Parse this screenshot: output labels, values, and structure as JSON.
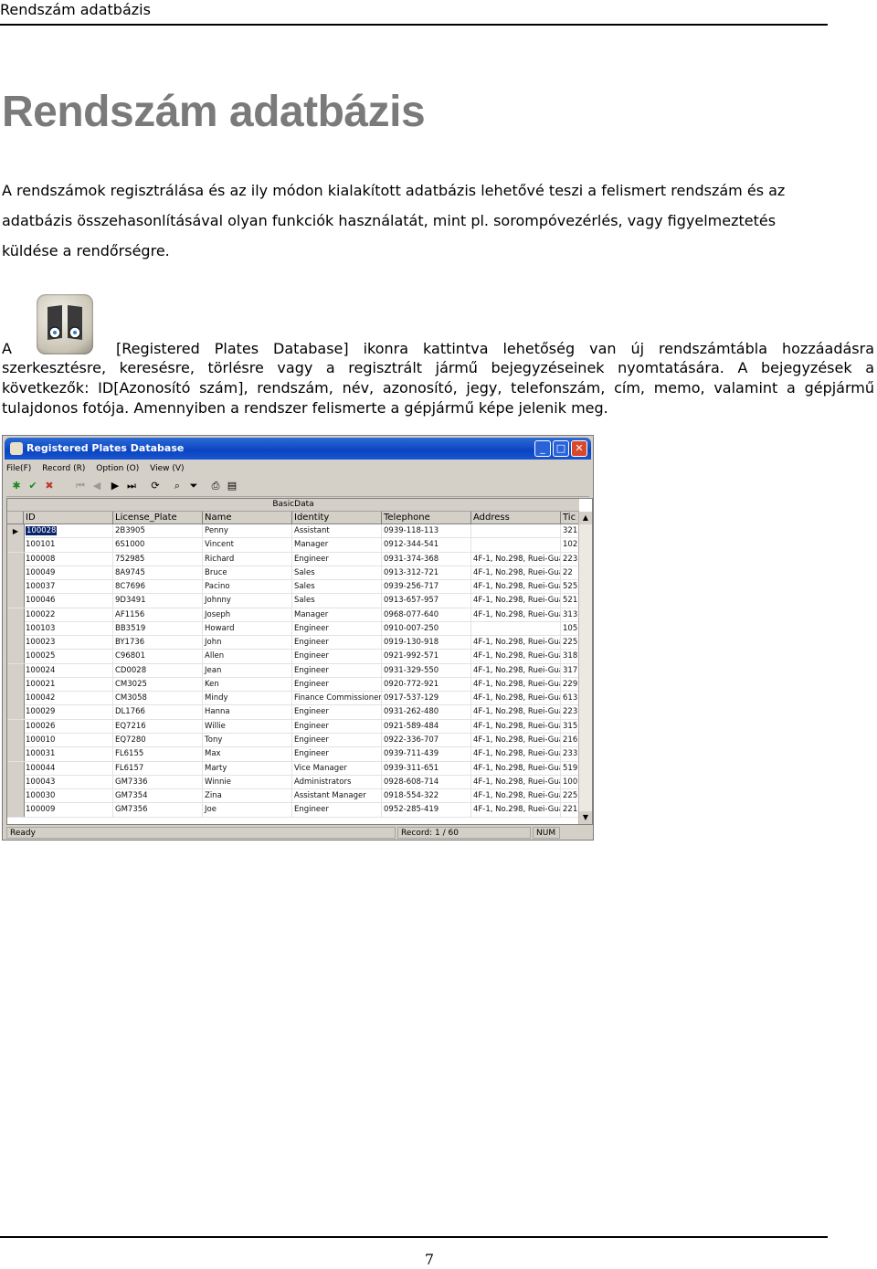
{
  "header": {
    "running_title": "Rendszám adatbázis"
  },
  "title": "Rendszám adatbázis",
  "intro_lines": [
    "A rendszámok regisztrálása és az ily módon kialakított adatbázis lehetővé teszi a felismert rendszám és az",
    "adatbázis összehasonlításával olyan funkciók használatát, mint pl. sorompóvezérlés, vagy figyelmeztetés",
    "küldése a rendőrségre."
  ],
  "para2": {
    "first_word": "A",
    "first_line_rest": "[Registered Plates Database] ikonra kattintva lehetőség van új rendszámtábla hozzáadásra",
    "lines": [
      "szerkesztésre, keresésre, törlésre vagy a regisztrált jármű bejegyzéseinek nyomtatására. A bejegyzések a",
      "következők: ID[Azonosító szám], rendszám, név, azonosító, jegy, telefonszám, cím, memo, valamint a gépjármű",
      "tulajdonos fotója. Amennyiben a rendszer felismerte a gépjármű képe jelenik meg."
    ]
  },
  "window": {
    "title": "Registered Plates Database",
    "menu": [
      "File(F)",
      "Record (R)",
      "Option (O)",
      "View (V)"
    ],
    "band": "BasicData",
    "columns": [
      "ID",
      "License_Plate",
      "Name",
      "Identity",
      "Telephone",
      "Address",
      "Tic"
    ],
    "rows": [
      [
        "100028",
        "2B3905",
        "Penny",
        "Assistant",
        "0939-118-113",
        "",
        "321"
      ],
      [
        "100101",
        "6S1000",
        "Vincent",
        "Manager",
        "0912-344-541",
        "",
        "102"
      ],
      [
        "100008",
        "752985",
        "Richard",
        "Engineer",
        "0931-374-368",
        "4F-1, No.298, Ruei-Gua",
        "223"
      ],
      [
        "100049",
        "8A9745",
        "Bruce",
        "Sales",
        "0913-312-721",
        "4F-1, No.298, Ruei-Gua",
        "22"
      ],
      [
        "100037",
        "8C7696",
        "Pacino",
        "Sales",
        "0939-256-717",
        "4F-1, No.298, Ruei-Gua",
        "525"
      ],
      [
        "100046",
        "9D3491",
        "Johnny",
        "Sales",
        "0913-657-957",
        "4F-1, No.298, Ruei-Gua",
        "521"
      ],
      [
        "100022",
        "AF1156",
        "Joseph",
        "Manager",
        "0968-077-640",
        "4F-1, No.298, Ruei-Gua",
        "313"
      ],
      [
        "100103",
        "BB3519",
        "Howard",
        "Engineer",
        "0910-007-250",
        "",
        "105"
      ],
      [
        "100023",
        "BY1736",
        "John",
        "Engineer",
        "0919-130-918",
        "4F-1, No.298, Ruei-Gua",
        "225"
      ],
      [
        "100025",
        "C96801",
        "Allen",
        "Engineer",
        "0921-992-571",
        "4F-1, No.298, Ruei-Gua",
        "318"
      ],
      [
        "100024",
        "CD0028",
        "Jean",
        "Engineer",
        "0931-329-550",
        "4F-1, No.298, Ruei-Gua",
        "317"
      ],
      [
        "100021",
        "CM3025",
        "Ken",
        "Engineer",
        "0920-772-921",
        "4F-1, No.298, Ruei-Gua",
        "229"
      ],
      [
        "100042",
        "CM3058",
        "Mindy",
        "Finance Commissioner",
        "0917-537-129",
        "4F-1, No.298, Ruei-Gua",
        "613"
      ],
      [
        "100029",
        "DL1766",
        "Hanna",
        "Engineer",
        "0931-262-480",
        "4F-1, No.298, Ruei-Gua",
        "223"
      ],
      [
        "100026",
        "EQ7216",
        "Willie",
        "Engineer",
        "0921-589-484",
        "4F-1, No.298, Ruei-Gua",
        "315"
      ],
      [
        "100010",
        "EQ7280",
        "Tony",
        "Engineer",
        "0922-336-707",
        "4F-1, No.298, Ruei-Gua",
        "216"
      ],
      [
        "100031",
        "FL6155",
        "Max",
        "Engineer",
        "0939-711-439",
        "4F-1, No.298, Ruei-Gua",
        "233"
      ],
      [
        "100044",
        "FL6157",
        "Marty",
        "Vice Manager",
        "0939-311-651",
        "4F-1, No.298, Ruei-Gua",
        "519"
      ],
      [
        "100043",
        "GM7336",
        "Winnie",
        "Administrators",
        "0928-608-714",
        "4F-1, No.298, Ruei-Gua",
        "100"
      ],
      [
        "100030",
        "GM7354",
        "Zina",
        "Assistant Manager",
        "0918-554-322",
        "4F-1, No.298, Ruei-Gua",
        "225"
      ],
      [
        "100009",
        "GM7356",
        "Joe",
        "Engineer",
        "0952-285-419",
        "4F-1, No.298, Ruei-Gua",
        "221"
      ]
    ],
    "status": {
      "left": "Ready",
      "record": "Record: 1 / 60",
      "num": "NUM"
    }
  },
  "footer": {
    "page_number": "7"
  }
}
